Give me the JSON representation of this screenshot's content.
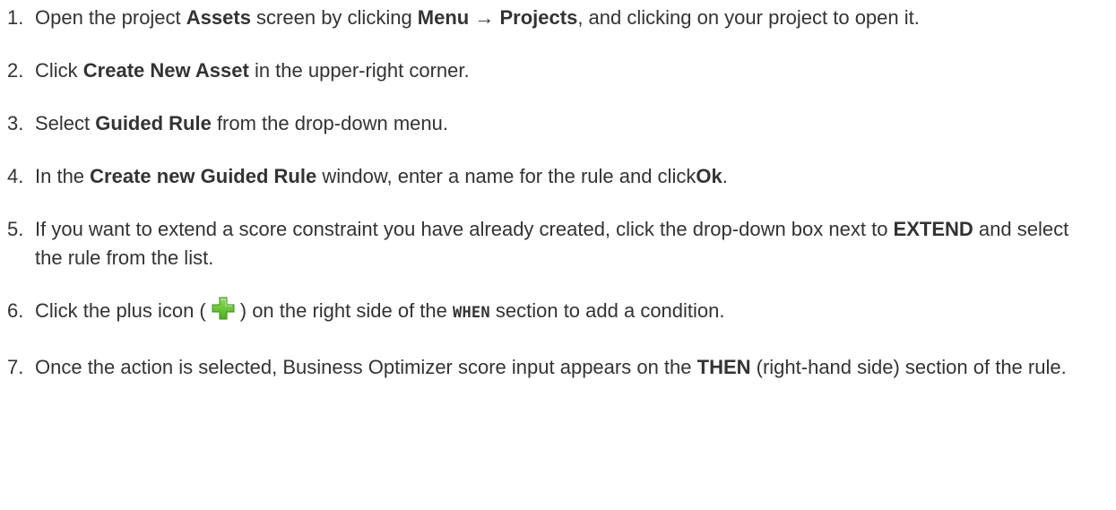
{
  "steps": [
    {
      "num": "1.",
      "parts": [
        {
          "t": "Open the project ",
          "b": false
        },
        {
          "t": "Assets",
          "b": true
        },
        {
          "t": " screen by clicking ",
          "b": false
        },
        {
          "t": "Menu",
          "b": true
        },
        {
          "t": " → ",
          "b": false
        },
        {
          "t": "Projects",
          "b": true
        },
        {
          "t": ", and clicking on your project to open it.",
          "b": false
        }
      ]
    },
    {
      "num": "2.",
      "parts": [
        {
          "t": "Click ",
          "b": false
        },
        {
          "t": "Create New Asset",
          "b": true
        },
        {
          "t": " in the upper-right corner.",
          "b": false
        }
      ]
    },
    {
      "num": "3.",
      "parts": [
        {
          "t": "Select ",
          "b": false
        },
        {
          "t": "Guided Rule",
          "b": true
        },
        {
          "t": " from the drop-down menu.",
          "b": false
        }
      ]
    },
    {
      "num": "4.",
      "parts": [
        {
          "t": "In the ",
          "b": false
        },
        {
          "t": "Create new Guided Rule",
          "b": true
        },
        {
          "t": " window, enter a name for the rule and click",
          "b": false
        },
        {
          "t": "Ok",
          "b": true
        },
        {
          "t": ".",
          "b": false
        }
      ]
    },
    {
      "num": "5.",
      "parts": [
        {
          "t": "If you want to extend a score constraint you have already created, click the drop-down box next to ",
          "b": false
        },
        {
          "t": "EXTEND",
          "b": true
        },
        {
          "t": " and select the rule from the list.",
          "b": false
        }
      ]
    },
    {
      "num": "6.",
      "parts": [
        {
          "t": "Click the plus icon (",
          "b": false
        },
        {
          "icon": "plus-icon"
        },
        {
          "t": ") on the right side of the ",
          "b": false
        },
        {
          "t": "WHEN",
          "code": true
        },
        {
          "t": " section to add a condition.",
          "b": false
        }
      ]
    },
    {
      "num": "7.",
      "parts": [
        {
          "t": "Once the action is selected, Business Optimizer score input appears on the ",
          "b": false
        },
        {
          "t": "THEN",
          "b": true
        },
        {
          "t": " (right-hand side) section of the rule.",
          "b": false
        }
      ]
    }
  ],
  "colors": {
    "text": "#333333",
    "icon_green": "#4caf1f",
    "icon_green_light": "#8fdc5a"
  }
}
